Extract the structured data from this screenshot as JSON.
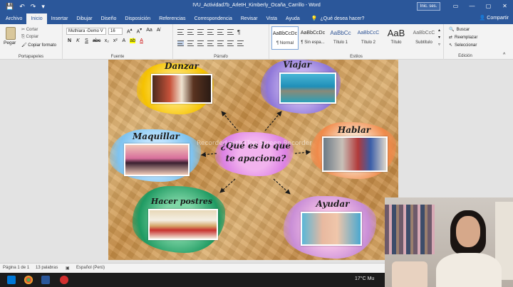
{
  "window": {
    "title": "IVU_Actividad7b_ArletH_Kimberly_Ocaña_Carrillo  -  Word",
    "signin": "Inic. ses.",
    "min": "—",
    "max": "▢",
    "close": "✕"
  },
  "menu": {
    "tabs": [
      "Archivo",
      "Inicio",
      "Insertar",
      "Dibujar",
      "Diseño",
      "Disposición",
      "Referencias",
      "Correspondencia",
      "Revisar",
      "Vista",
      "Ayuda"
    ],
    "tell_me": "¿Qué desea hacer?",
    "share": "Compartir"
  },
  "ribbon": {
    "clipboard": {
      "paste": "Pegar",
      "cut": "Cortar",
      "copy": "Copiar",
      "format_painter": "Copiar formato",
      "label": "Portapapeles"
    },
    "font": {
      "name": "Muthiara -Demo V",
      "size": "16",
      "label": "Fuente"
    },
    "paragraph": {
      "label": "Párrafo"
    },
    "styles": {
      "label": "Estilos",
      "items": [
        {
          "preview": "AaBbCcDc",
          "name": "¶ Normal"
        },
        {
          "preview": "AaBbCcDc",
          "name": "¶ Sin espa..."
        },
        {
          "preview": "AaBbCc",
          "name": "Título 1"
        },
        {
          "preview": "AaBbCcC",
          "name": "Título 2"
        },
        {
          "preview": "AaB",
          "name": "Título"
        },
        {
          "preview": "AaBbCcC",
          "name": "Subtítulo"
        }
      ]
    },
    "editing": {
      "find": "Buscar",
      "replace": "Reemplazar",
      "select": "Seleccionar",
      "label": "Edición"
    }
  },
  "document": {
    "center": "¿Qué es lo que te apaciona?",
    "watermark": "Recorded with iTop Screen Recorder",
    "nodes": {
      "danzar": "Danzar",
      "viajar": "Viajar",
      "maquillar": "Maquillar",
      "hablar": "Hablar",
      "hacer_postres": "Hacer postres",
      "ayudar": "Ayudar"
    }
  },
  "status": {
    "page": "Página 1 de 1",
    "words": "13 palabras",
    "language": "Español (Perú)"
  },
  "taskbar": {
    "weather": "17°C  Mu"
  },
  "colors": {
    "word_blue": "#2b579a",
    "ribbon_bg": "#f3f3f3"
  }
}
